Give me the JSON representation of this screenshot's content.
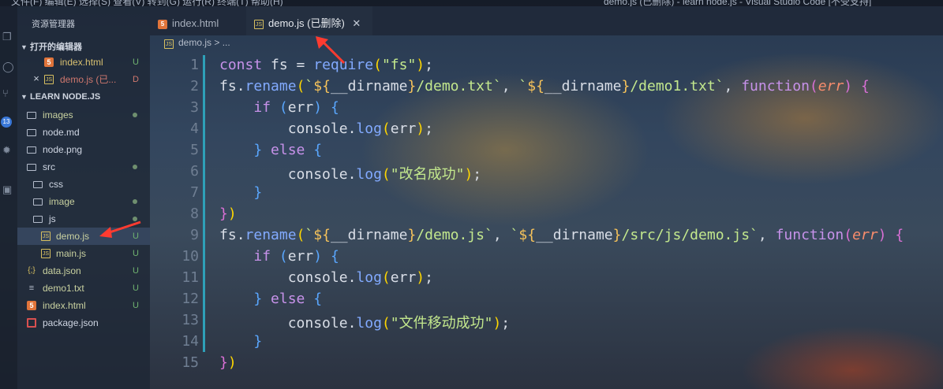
{
  "titlebar": {
    "menu": "文件(F)    编辑(E)    选择(S)    查看(V)    转到(G)    运行(R)    终端(T)    帮助(H)",
    "title": "demo.js (已删除) - learn node.js - Visual Studio Code [不受支持]"
  },
  "activity": {
    "badge": "13"
  },
  "sidebar": {
    "title": "资源管理器",
    "open_editors_label": "打开的编辑器",
    "open_editors": [
      {
        "name": "index.html",
        "status": "U"
      },
      {
        "name": "demo.js (已...",
        "status": "D"
      }
    ],
    "project_label": "LEARN NODE.JS",
    "tree": [
      {
        "name": "images"
      },
      {
        "name": "node.md"
      },
      {
        "name": "node.png"
      },
      {
        "name": "src"
      },
      {
        "name": "css"
      },
      {
        "name": "image"
      },
      {
        "name": "js"
      },
      {
        "name": "demo.js",
        "status": "U"
      },
      {
        "name": "main.js",
        "status": "U"
      },
      {
        "name": "data.json",
        "status": "U"
      },
      {
        "name": "demo1.txt",
        "status": "U"
      },
      {
        "name": "index.html",
        "status": "U"
      },
      {
        "name": "package.json"
      }
    ]
  },
  "tabs": [
    {
      "label": "index.html"
    },
    {
      "label": "demo.js (已删除)"
    }
  ],
  "breadcrumb": "demo.js > ...",
  "editor": {
    "line_numbers": [
      "1",
      "2",
      "3",
      "4",
      "5",
      "6",
      "7",
      "8",
      "9",
      "10",
      "11",
      "12",
      "13",
      "14",
      "15"
    ],
    "lines": [
      "const fs = require(\"fs\");",
      "fs.rename(`${__dirname}/demo.txt`, `${__dirname}/demo1.txt`, function(err) {",
      "    if (err) {",
      "        console.log(err);",
      "    } else {",
      "        console.log(\"改名成功\");",
      "    }",
      "})",
      "fs.rename(`${__dirname}/demo.js`, `${__dirname}/src/js/demo.js`, function(err) {",
      "    if (err) {",
      "        console.log(err);",
      "    } else {",
      "        console.log(\"文件移动成功\");",
      "    }",
      "})"
    ]
  },
  "colors": {
    "accent": "#2ea0b8",
    "arrow": "#ff3b30"
  }
}
